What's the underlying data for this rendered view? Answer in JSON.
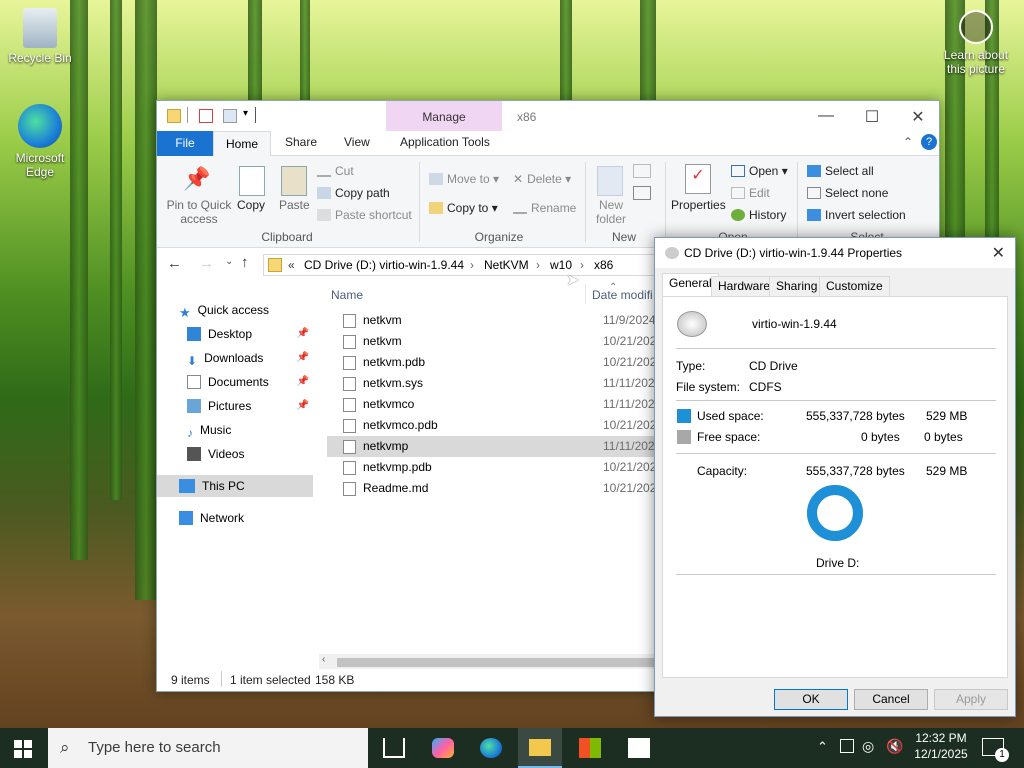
{
  "desktop": {
    "icons": [
      {
        "label": "Recycle Bin"
      },
      {
        "label": "Microsoft Edge"
      }
    ],
    "learn_about": "Learn about this picture"
  },
  "explorer": {
    "title_path": "x86",
    "manage_label": "Manage",
    "tabs": [
      "File",
      "Home",
      "Share",
      "View",
      "Application Tools"
    ],
    "ribbon": {
      "clipboard": {
        "pin": "Pin to Quick access",
        "copy": "Copy",
        "paste": "Paste",
        "cut": "Cut",
        "copy_path": "Copy path",
        "paste_shortcut": "Paste shortcut",
        "group": "Clipboard"
      },
      "organize": {
        "move_to": "Move to",
        "delete": "Delete",
        "copy_to": "Copy to",
        "rename": "Rename",
        "group": "Organize"
      },
      "new": {
        "new_folder": "New folder",
        "group": "New"
      },
      "open": {
        "properties": "Properties",
        "open": "Open",
        "edit": "Edit",
        "history": "History",
        "group": "Open"
      },
      "select": {
        "select_all": "Select all",
        "select_none": "Select none",
        "invert": "Invert selection",
        "group": "Select"
      }
    },
    "breadcrumb": [
      "CD Drive (D:) virtio-win-1.9.44",
      "NetKVM",
      "w10",
      "x86"
    ],
    "nav": {
      "quick_access": "Quick access",
      "items": [
        "Desktop",
        "Downloads",
        "Documents",
        "Pictures",
        "Music",
        "Videos"
      ],
      "this_pc": "This PC",
      "network": "Network"
    },
    "columns": {
      "name": "Name",
      "date": "Date modifi"
    },
    "files": [
      {
        "name": "netkvm",
        "date": "11/9/2024 1"
      },
      {
        "name": "netkvm",
        "date": "10/21/2024"
      },
      {
        "name": "netkvm.pdb",
        "date": "10/21/2024"
      },
      {
        "name": "netkvm.sys",
        "date": "11/11/2024"
      },
      {
        "name": "netkvmco",
        "date": "11/11/2024"
      },
      {
        "name": "netkvmco.pdb",
        "date": "10/21/2024"
      },
      {
        "name": "netkvmp",
        "date": "11/11/2024"
      },
      {
        "name": "netkvmp.pdb",
        "date": "10/21/2024"
      },
      {
        "name": "Readme.md",
        "date": "10/21/2024"
      }
    ],
    "status": {
      "items": "9 items",
      "selected": "1 item selected",
      "size": "158 KB"
    }
  },
  "properties": {
    "title": "CD Drive (D:) virtio-win-1.9.44 Properties",
    "tabs": [
      "General",
      "Hardware",
      "Sharing",
      "Customize"
    ],
    "label": "virtio-win-1.9.44",
    "type_label": "Type:",
    "type_value": "CD Drive",
    "fs_label": "File system:",
    "fs_value": "CDFS",
    "used_label": "Used space:",
    "used_bytes": "555,337,728 bytes",
    "used_mb": "529 MB",
    "free_label": "Free space:",
    "free_bytes": "0 bytes",
    "free_mb": "0 bytes",
    "cap_label": "Capacity:",
    "cap_bytes": "555,337,728 bytes",
    "cap_mb": "529 MB",
    "drive_label": "Drive D:",
    "used_fraction": 1.0,
    "buttons": {
      "ok": "OK",
      "cancel": "Cancel",
      "apply": "Apply"
    },
    "colors": {
      "used": "#1e90d8",
      "free": "#a8a8a8"
    }
  },
  "taskbar": {
    "search_placeholder": "Type here to search",
    "time": "12:32 PM",
    "date": "12/1/2025",
    "notif_count": "1"
  }
}
